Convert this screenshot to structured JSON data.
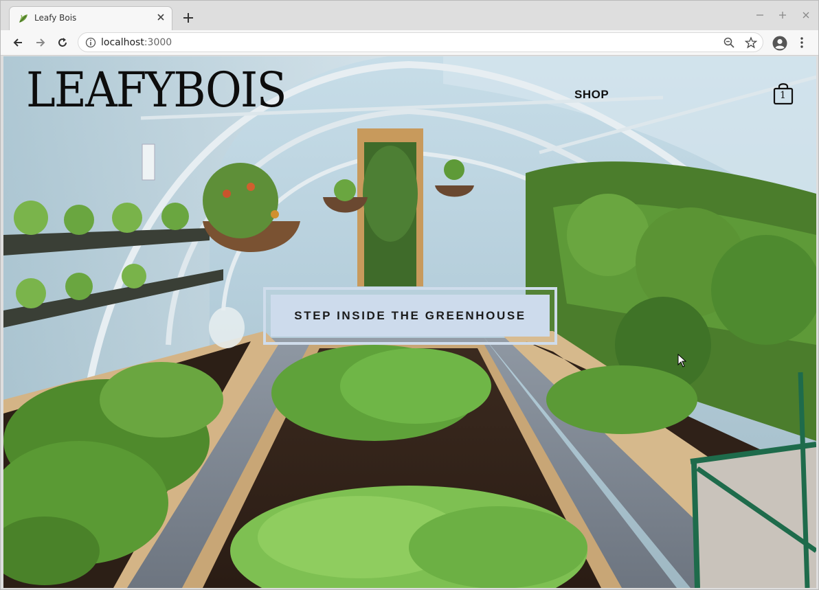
{
  "browser": {
    "tab_title": "Leafy Bois",
    "url_host": "localhost",
    "url_port": ":3000",
    "icons": [
      "leaf-favicon-icon",
      "close-icon",
      "plus-icon",
      "minimize-icon",
      "maximize-icon",
      "window-close-icon",
      "back-arrow-icon",
      "forward-arrow-icon",
      "reload-icon",
      "info-icon",
      "zoom-out-icon",
      "star-icon",
      "profile-icon",
      "kebab-menu-icon"
    ]
  },
  "site": {
    "brand": "LEAFYBOIS",
    "nav_shop": "SHOP",
    "cart_count": "1",
    "cta_label": "STEP INSIDE THE GREENHOUSE"
  },
  "colors": {
    "cta_bg": "#cddbec",
    "cta_border": "#cfdceb",
    "text_dark": "#111111"
  }
}
